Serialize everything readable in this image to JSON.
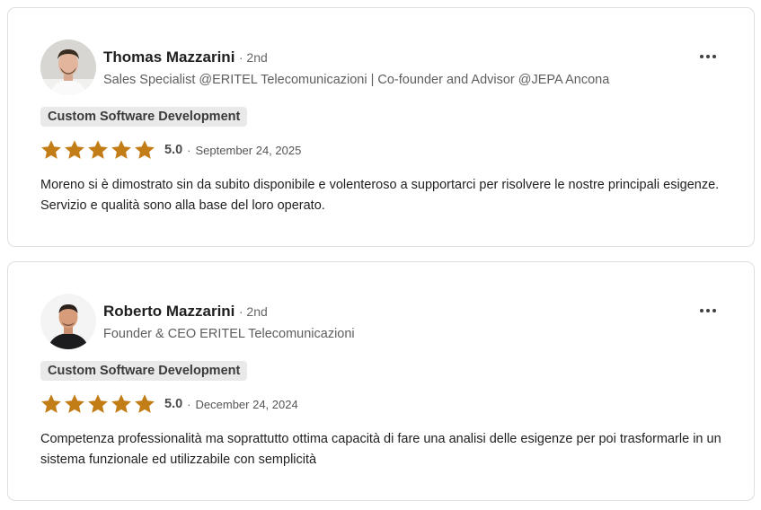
{
  "reviews": [
    {
      "author": "Thomas Mazzarini",
      "degree": "· 2nd",
      "headline": "Sales Specialist @ERITEL Telecomunicazioni | Co-founder and Advisor @JEPA Ancona",
      "service_tag": "Custom Software Development",
      "rating": 5,
      "score": "5.0",
      "separator": "·",
      "date": "September 24, 2025",
      "text": "Moreno si è dimostrato sin da subito disponibile e volenteroso a supportarci per risolvere le nostre principali esigenze. Servizio e qualità sono alla base del loro operato.",
      "menu_icon": "more-horizontal-icon"
    },
    {
      "author": "Roberto Mazzarini",
      "degree": "· 2nd",
      "headline": "Founder & CEO ERITEL Telecomunicazioni",
      "service_tag": "Custom Software Development",
      "rating": 5,
      "score": "5.0",
      "separator": "·",
      "date": "December 24, 2024",
      "text": "Competenza professionalità ma soprattutto ottima capacità di fare una analisi delle esigenze per poi trasformarle in un sistema funzionale ed utilizzabile con semplicità",
      "menu_icon": "more-horizontal-icon"
    }
  ],
  "colors": {
    "star": "#c37d16",
    "tag_bg": "#e9e9e9",
    "card_border": "#e0dfdc"
  }
}
